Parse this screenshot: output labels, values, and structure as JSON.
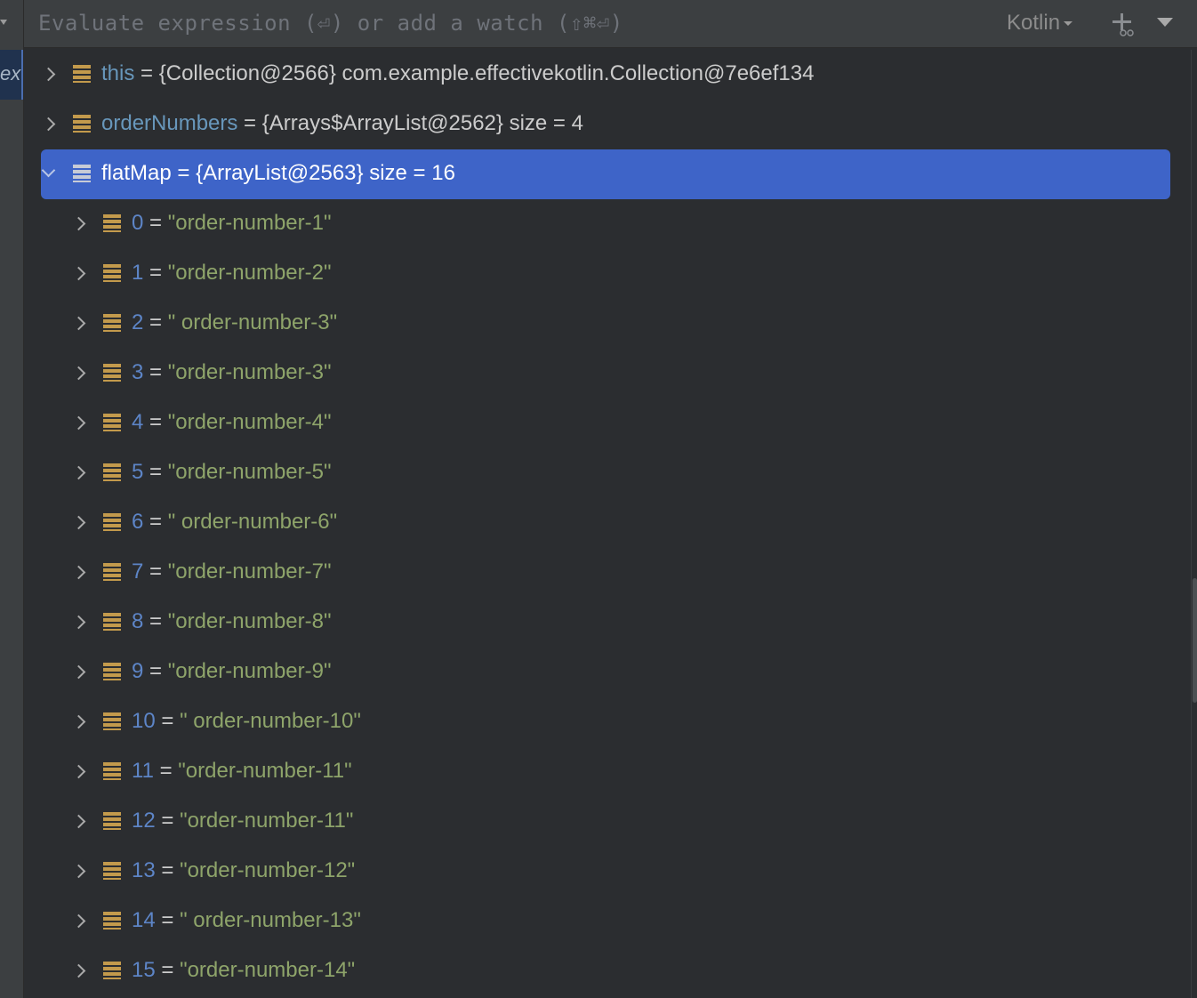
{
  "frames_gutter": {
    "frame_label": "ex"
  },
  "eval_bar": {
    "placeholder": "Evaluate expression (⏎) or add a watch (⇧⌘⏎)",
    "language": "Kotlin"
  },
  "variables": [
    {
      "name": "this",
      "value": "{Collection@2566} com.example.effectivekotlin.Collection@7e6ef134",
      "kind": "object",
      "expanded": false,
      "selected": false,
      "depth": 0
    },
    {
      "name": "orderNumbers",
      "value": "{Arrays$ArrayList@2562}  size = 4",
      "kind": "object",
      "expanded": false,
      "selected": false,
      "depth": 0
    },
    {
      "name": "flatMap",
      "value": "{ArrayList@2563}  size = 16",
      "kind": "object",
      "expanded": true,
      "selected": true,
      "depth": 0
    },
    {
      "name": "0",
      "value": "\"order-number-1\"",
      "kind": "string",
      "depth": 1
    },
    {
      "name": "1",
      "value": "\"order-number-2\"",
      "kind": "string",
      "depth": 1
    },
    {
      "name": "2",
      "value": "\" order-number-3\"",
      "kind": "string",
      "depth": 1
    },
    {
      "name": "3",
      "value": "\"order-number-3\"",
      "kind": "string",
      "depth": 1
    },
    {
      "name": "4",
      "value": "\"order-number-4\"",
      "kind": "string",
      "depth": 1
    },
    {
      "name": "5",
      "value": "\"order-number-5\"",
      "kind": "string",
      "depth": 1
    },
    {
      "name": "6",
      "value": "\" order-number-6\"",
      "kind": "string",
      "depth": 1
    },
    {
      "name": "7",
      "value": "\"order-number-7\"",
      "kind": "string",
      "depth": 1
    },
    {
      "name": "8",
      "value": "\"order-number-8\"",
      "kind": "string",
      "depth": 1
    },
    {
      "name": "9",
      "value": "\"order-number-9\"",
      "kind": "string",
      "depth": 1
    },
    {
      "name": "10",
      "value": "\" order-number-10\"",
      "kind": "string",
      "depth": 1
    },
    {
      "name": "11",
      "value": "\"order-number-11\"",
      "kind": "string",
      "depth": 1
    },
    {
      "name": "12",
      "value": "\"order-number-11\"",
      "kind": "string",
      "depth": 1
    },
    {
      "name": "13",
      "value": "\"order-number-12\"",
      "kind": "string",
      "depth": 1
    },
    {
      "name": "14",
      "value": "\" order-number-13\"",
      "kind": "string",
      "depth": 1
    },
    {
      "name": "15",
      "value": "\"order-number-14\"",
      "kind": "string",
      "depth": 1
    }
  ],
  "icons": {
    "expand": "chevron-right-icon",
    "collapse": "chevron-down-icon",
    "field": "field-icon",
    "add_watch": "add-watch-icon",
    "more": "triangle-down-icon"
  },
  "colors": {
    "selection": "#3e64c8",
    "name": "#6897bb",
    "string_value": "#8ea46a",
    "field_icon": "#c39a4c"
  }
}
